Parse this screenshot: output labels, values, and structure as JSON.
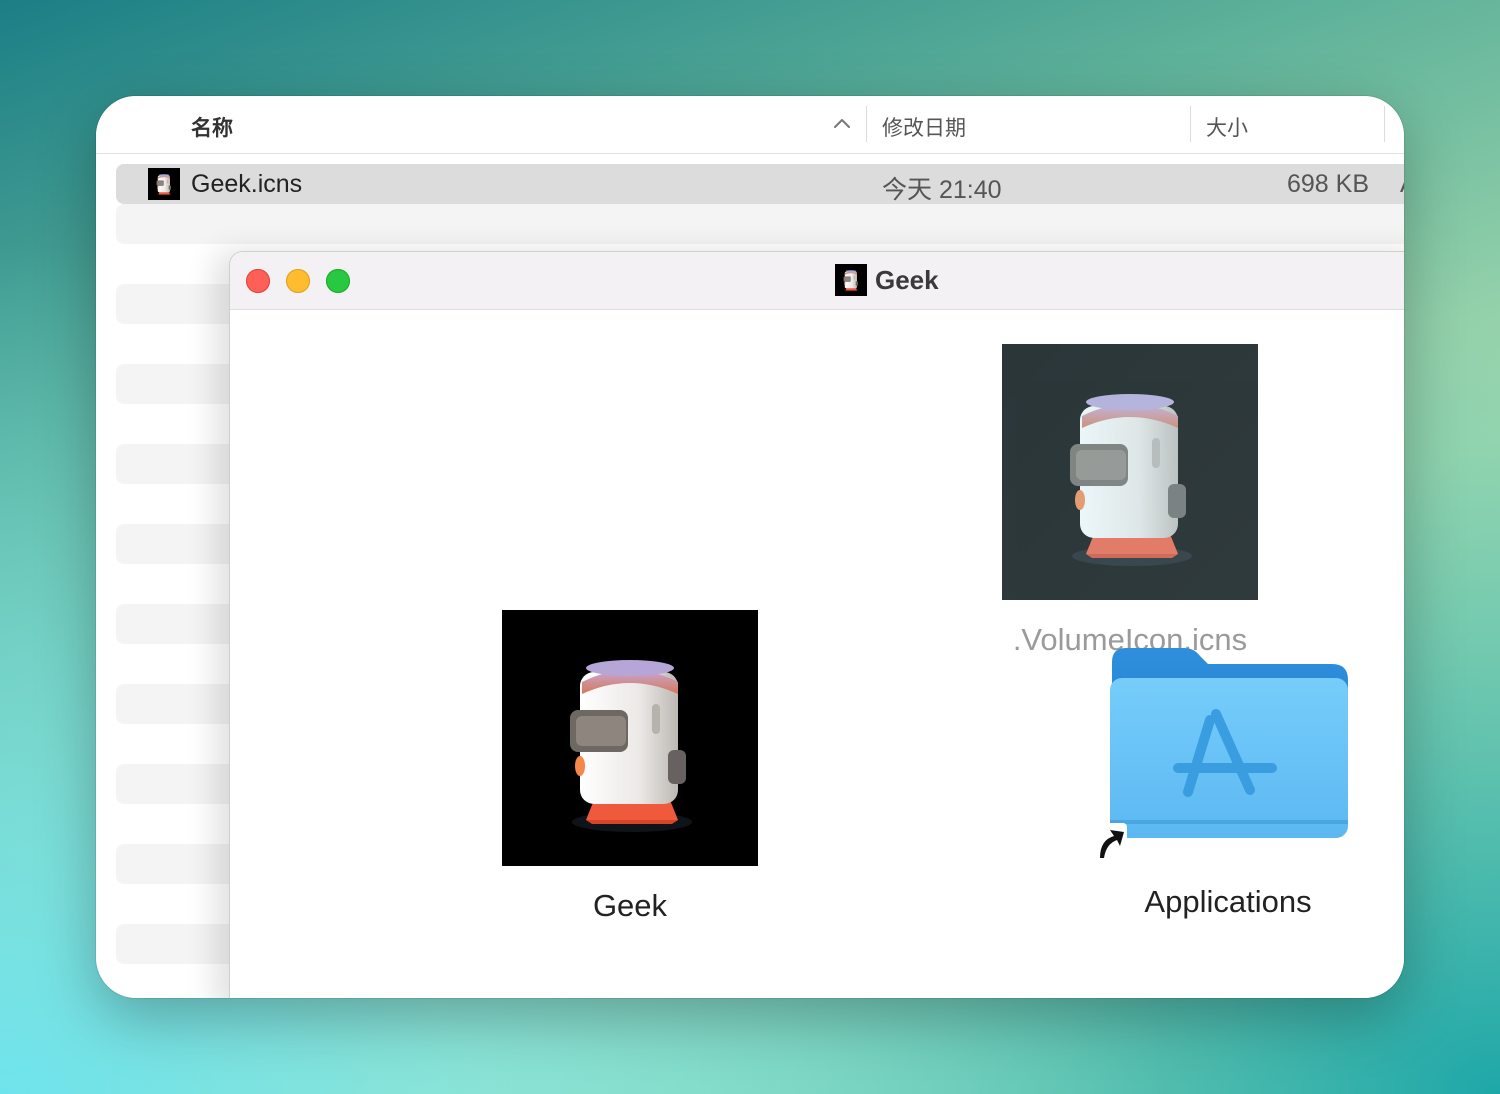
{
  "background": {
    "gradient_colors": [
      "#1c7f86",
      "#a6dcb0",
      "#6fe3ec"
    ]
  },
  "finder_list": {
    "columns": {
      "name": "名称",
      "date_modified": "修改日期",
      "size": "大小"
    },
    "sort_indicator": "chevron-up-icon",
    "rows": [
      {
        "icon": "geek-robot-icon",
        "name": "Geek.icns",
        "date_modified": "今天 21:40",
        "size": "698 KB",
        "kind_fragment": "A"
      }
    ]
  },
  "dmg_window": {
    "title": "Geek",
    "title_icon": "geek-robot-icon",
    "traffic_lights": {
      "close": "#fe5f57",
      "minimize": "#febc2e",
      "zoom": "#28c840"
    },
    "items": [
      {
        "label": "Geek",
        "icon": "geek-robot-image",
        "dimmed": false
      },
      {
        "label": ".VolumeIcon.icns",
        "icon": "geek-robot-image",
        "dimmed": true
      },
      {
        "label": "Applications",
        "icon": "applications-folder-icon",
        "alias": true,
        "dimmed": false
      }
    ]
  }
}
